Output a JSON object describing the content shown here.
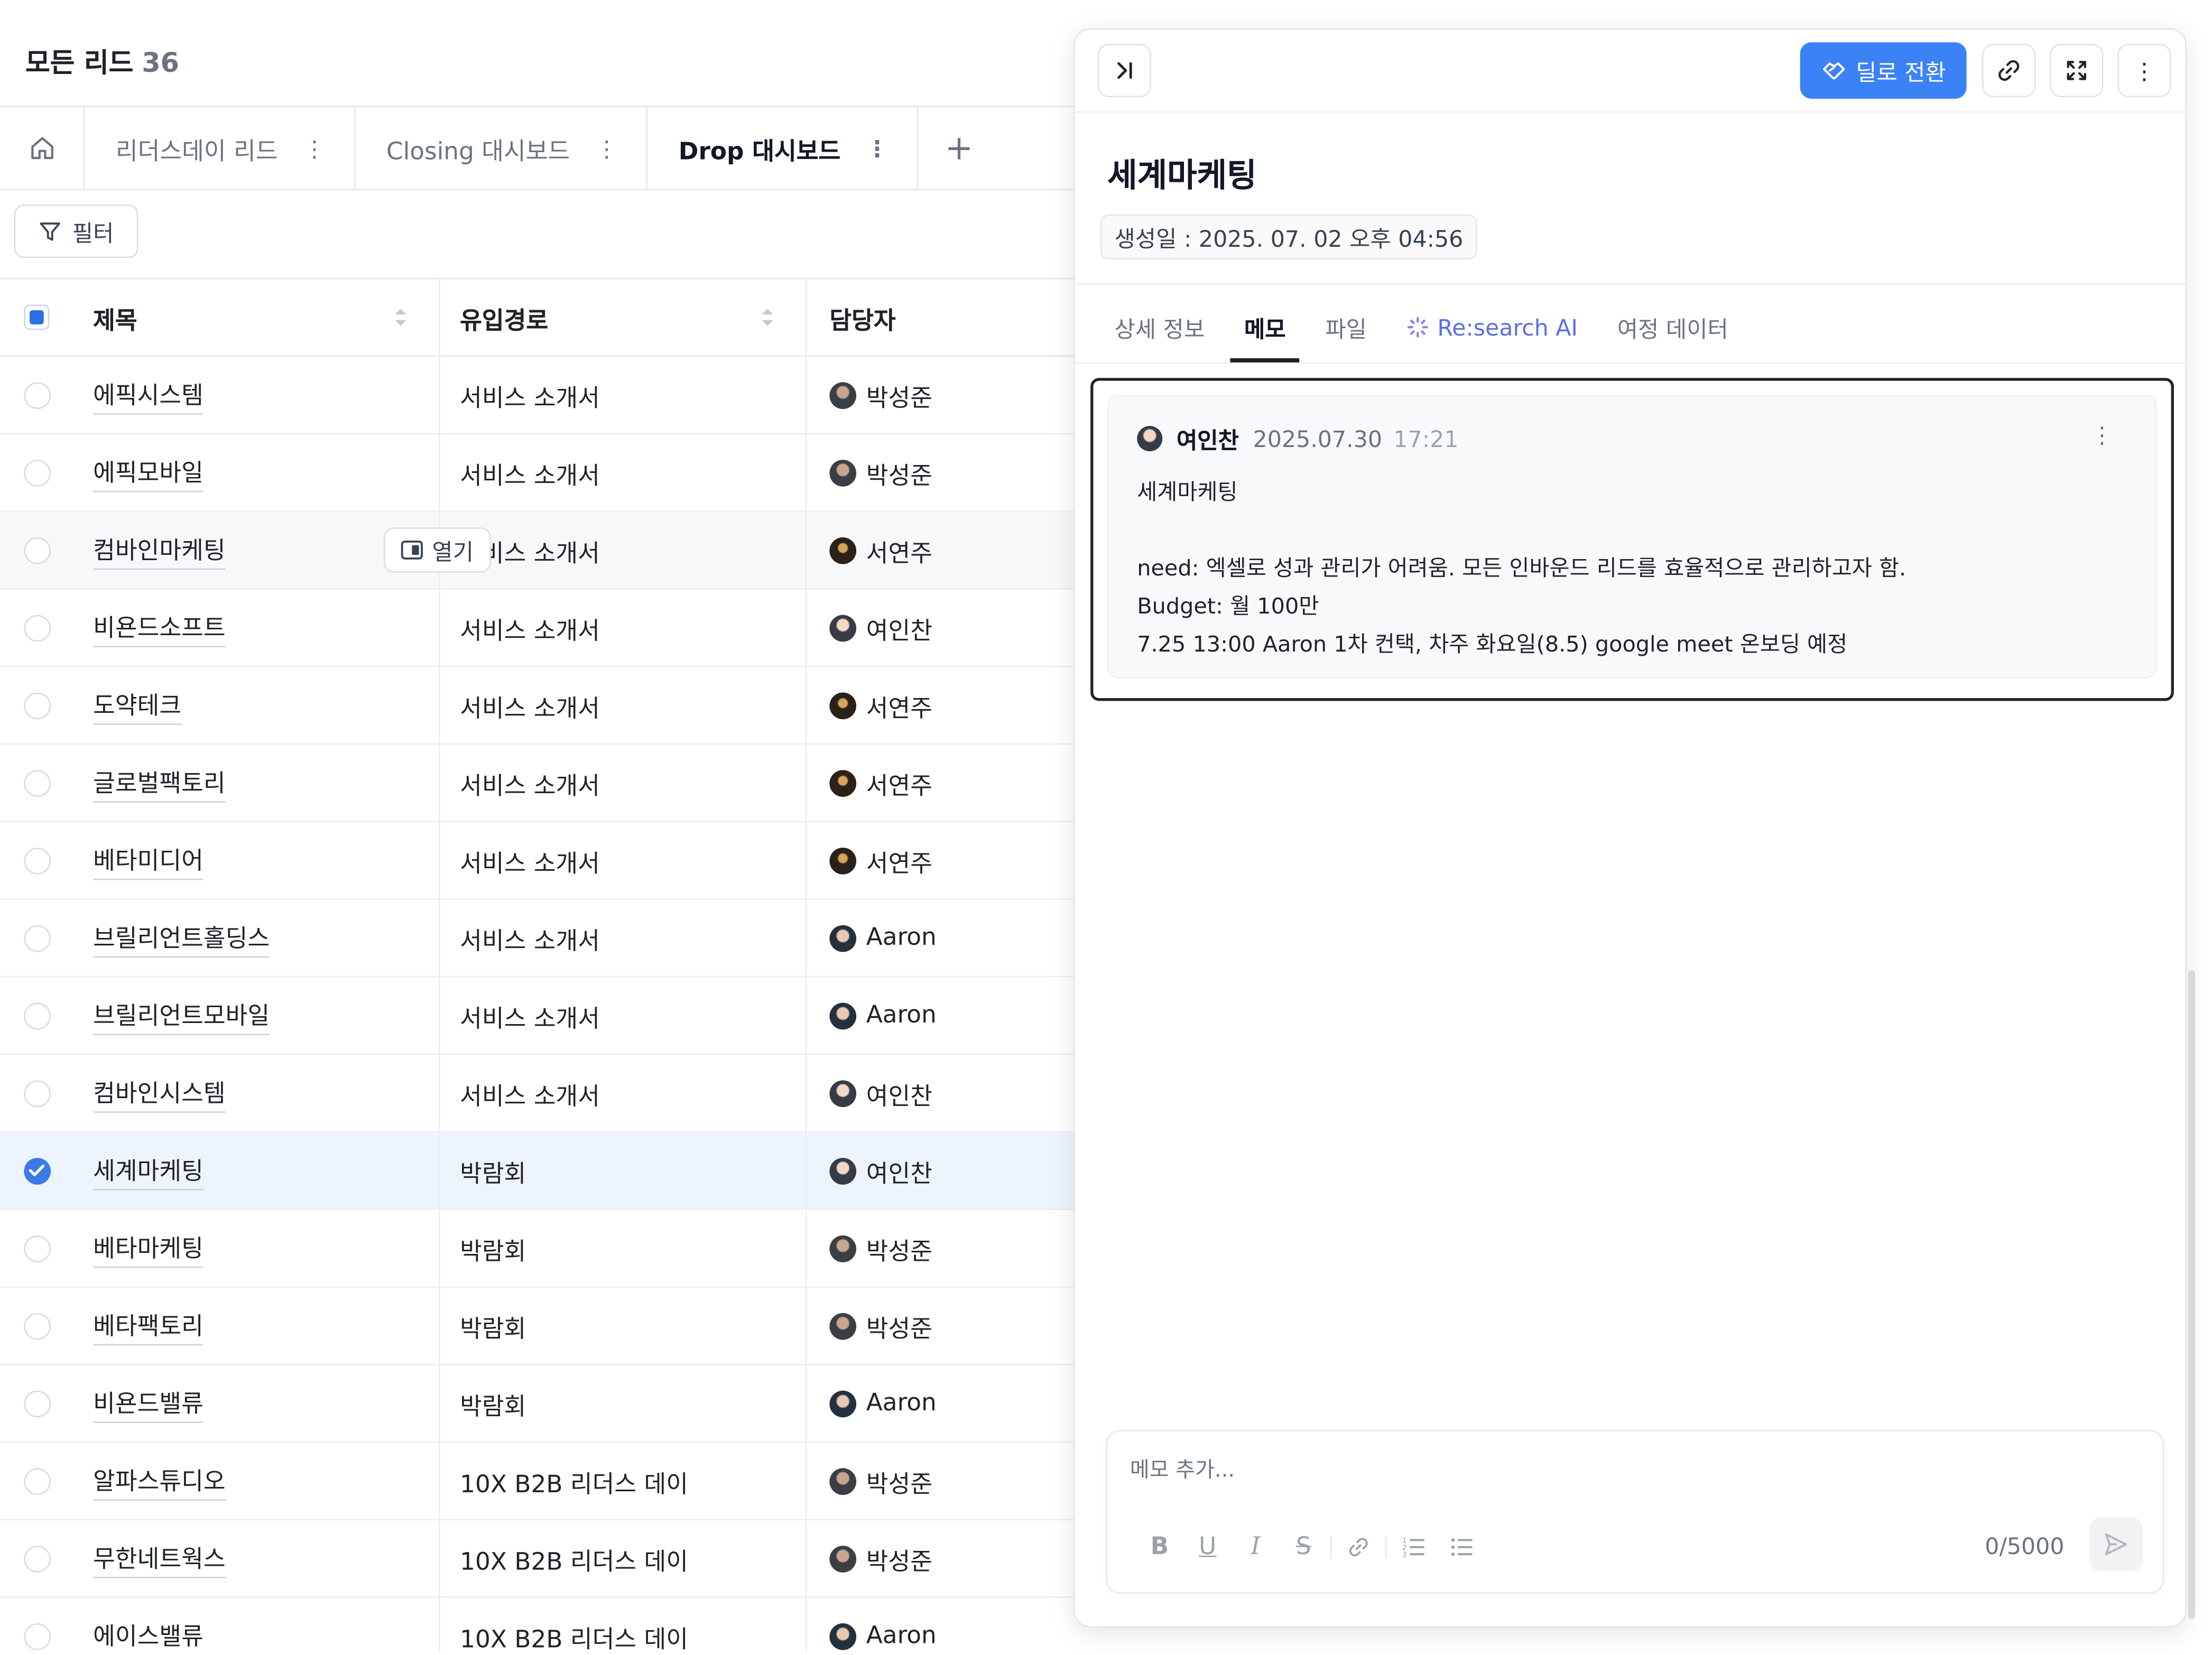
{
  "page": {
    "title": "모든 리드",
    "count": "36"
  },
  "tabs": [
    {
      "label": "리더스데이 리드"
    },
    {
      "label": "Closing 대시보드"
    },
    {
      "label": "Drop 대시보드"
    }
  ],
  "filter": {
    "label": "필터"
  },
  "table": {
    "headers": {
      "title": "제목",
      "source": "유입경로",
      "owner": "담당자"
    },
    "open_label": "열기",
    "rows": [
      {
        "title": "에픽시스템",
        "source": "서비스 소개서",
        "owner": "박성준"
      },
      {
        "title": "에픽모바일",
        "source": "서비스 소개서",
        "owner": "박성준"
      },
      {
        "title": "컴바인마케팅",
        "source": "서비스 소개서",
        "owner": "서연주"
      },
      {
        "title": "비욘드소프트",
        "source": "서비스 소개서",
        "owner": "여인찬"
      },
      {
        "title": "도약테크",
        "source": "서비스 소개서",
        "owner": "서연주"
      },
      {
        "title": "글로벌팩토리",
        "source": "서비스 소개서",
        "owner": "서연주"
      },
      {
        "title": "베타미디어",
        "source": "서비스 소개서",
        "owner": "서연주"
      },
      {
        "title": "브릴리언트홀딩스",
        "source": "서비스 소개서",
        "owner": "Aaron"
      },
      {
        "title": "브릴리언트모바일",
        "source": "서비스 소개서",
        "owner": "Aaron"
      },
      {
        "title": "컴바인시스템",
        "source": "서비스 소개서",
        "owner": "여인찬"
      },
      {
        "title": "세계마케팅",
        "source": "박람회",
        "owner": "여인찬"
      },
      {
        "title": "베타마케팅",
        "source": "박람회",
        "owner": "박성준"
      },
      {
        "title": "베타팩토리",
        "source": "박람회",
        "owner": "박성준"
      },
      {
        "title": "비욘드밸류",
        "source": "박람회",
        "owner": "Aaron"
      },
      {
        "title": "알파스튜디오",
        "source": "10X B2B 리더스 데이",
        "owner": "박성준"
      },
      {
        "title": "무한네트웍스",
        "source": "10X B2B 리더스 데이",
        "owner": "박성준"
      },
      {
        "title": "에이스밸류",
        "source": "10X B2B 리더스 데이",
        "owner": "Aaron"
      }
    ]
  },
  "panel": {
    "deal_button": "딜로 전환",
    "title": "세계마케팅",
    "created": "생성일 : 2025. 07. 02 오후 04:56",
    "tabs": {
      "detail": "상세 정보",
      "memo": "메모",
      "files": "파일",
      "ai": "Re:search AI",
      "journey": "여정 데이터"
    },
    "memo": {
      "author": "여인찬",
      "date": "2025.07.30",
      "time": "17:21",
      "line1": "세계마케팅",
      "line2": "need: 엑셀로 성과 관리가 어려움. 모든 인바운드 리드를 효율적으로 관리하고자 함.",
      "line3": "Budget: 월 100만",
      "line4": "7.25 13:00 Aaron 1차 컨택, 차주 화요일(8.5) google meet 온보딩 예정"
    },
    "composer": {
      "placeholder": "메모 추가...",
      "counter": "0/5000"
    }
  },
  "colors": {
    "accent": "#3b82f6",
    "selected_row": "#eef4fd",
    "ai": "#5b6ee6"
  }
}
